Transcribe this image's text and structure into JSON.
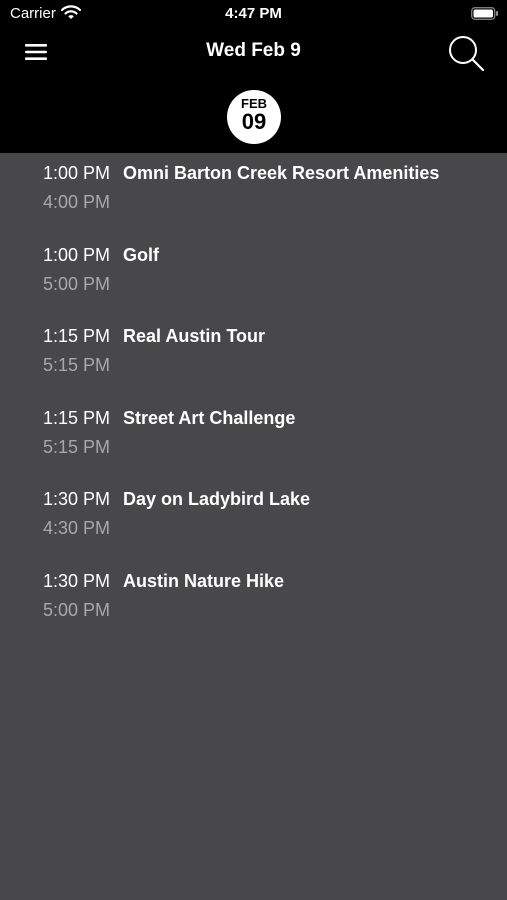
{
  "status_bar": {
    "carrier": "Carrier",
    "time": "4:47 PM"
  },
  "nav": {
    "title": "Wed Feb 9",
    "menu_icon": "hamburger-menu-icon",
    "search_icon": "search-icon"
  },
  "date_badge": {
    "month": "FEB",
    "day": "09"
  },
  "events": [
    {
      "start": "1:00 PM",
      "end": "4:00 PM",
      "name": "Omni Barton Creek Resort Amenities"
    },
    {
      "start": "1:00 PM",
      "end": "5:00 PM",
      "name": "Golf"
    },
    {
      "start": "1:15 PM",
      "end": "5:15 PM",
      "name": "Real Austin Tour"
    },
    {
      "start": "1:15 PM",
      "end": "5:15 PM",
      "name": "Street Art Challenge"
    },
    {
      "start": "1:30 PM",
      "end": "4:30 PM",
      "name": "Day on Ladybird Lake"
    },
    {
      "start": "1:30 PM",
      "end": "5:00 PM",
      "name": "Austin Nature Hike"
    }
  ],
  "colors": {
    "header_bg": "#000000",
    "list_bg": "#48484a",
    "primary_text": "#ffffff",
    "secondary_text": "#a8a8aa"
  }
}
